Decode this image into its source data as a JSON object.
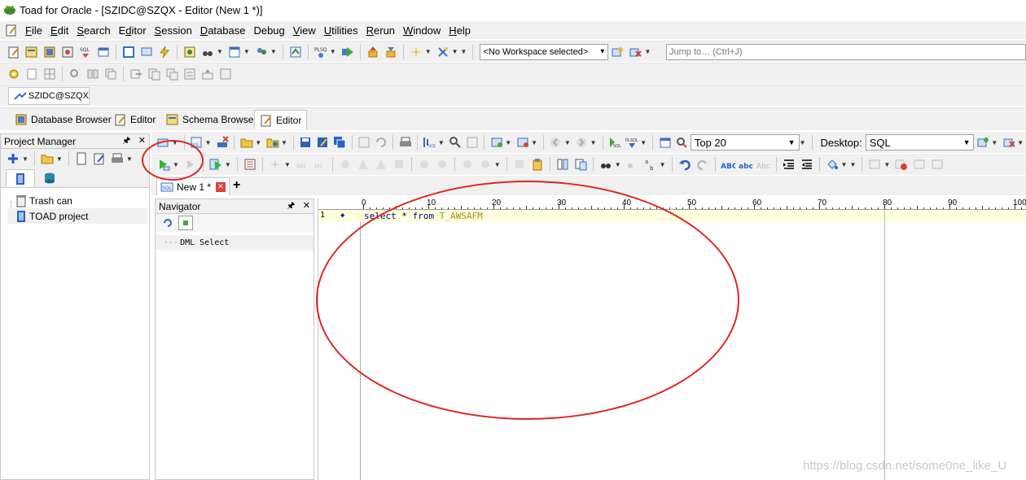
{
  "window": {
    "title": "Toad for Oracle - [SZIDC@SZQX - Editor (New 1 *)]"
  },
  "menu": [
    {
      "label": "File",
      "accel": "F"
    },
    {
      "label": "Edit",
      "accel": "E"
    },
    {
      "label": "Search",
      "accel": "S"
    },
    {
      "label": "Editor",
      "accel": "d"
    },
    {
      "label": "Session",
      "accel": "S"
    },
    {
      "label": "Database",
      "accel": "D"
    },
    {
      "label": "Debug",
      "accel": "g"
    },
    {
      "label": "View",
      "accel": "V"
    },
    {
      "label": "Utilities",
      "accel": "U"
    },
    {
      "label": "Rerun",
      "accel": "R"
    },
    {
      "label": "Window",
      "accel": "W"
    },
    {
      "label": "Help",
      "accel": "H"
    }
  ],
  "workspace": {
    "selected": "<No Workspace selected>"
  },
  "jump": {
    "placeholder": "Jump to… (Ctrl+J)"
  },
  "connection_tab": {
    "label": "SZIDC@SZQX"
  },
  "window_tabs": [
    {
      "label": "Database Browser"
    },
    {
      "label": "Editor"
    },
    {
      "label": "Schema Browser"
    },
    {
      "label": "Editor"
    }
  ],
  "project_manager": {
    "title": "Project Manager",
    "items": [
      {
        "label": "Trash can"
      },
      {
        "label": "TOAD project"
      }
    ]
  },
  "editor_toolbar": {
    "top_value": "Top 20",
    "desktop_label": "Desktop:",
    "desktop_value": "SQL"
  },
  "doc_tab": {
    "label": "New 1 *"
  },
  "navigator": {
    "title": "Navigator",
    "item": "DML Select"
  },
  "editor": {
    "ruler_labels": [
      "0",
      "10",
      "20",
      "30",
      "40",
      "50",
      "60",
      "70",
      "80",
      "90",
      "100"
    ],
    "line_number": "1",
    "code_keyword1": "select",
    "code_middle": " *",
    "code_keyword2": "from",
    "code_table": "T_AWSAFM"
  },
  "watermark": "https://blog.csdn.net/some0ne_like_U",
  "colors": {
    "annotation": "#e0241f",
    "current_line": "#ffffe0",
    "keyword": "#00008b"
  }
}
